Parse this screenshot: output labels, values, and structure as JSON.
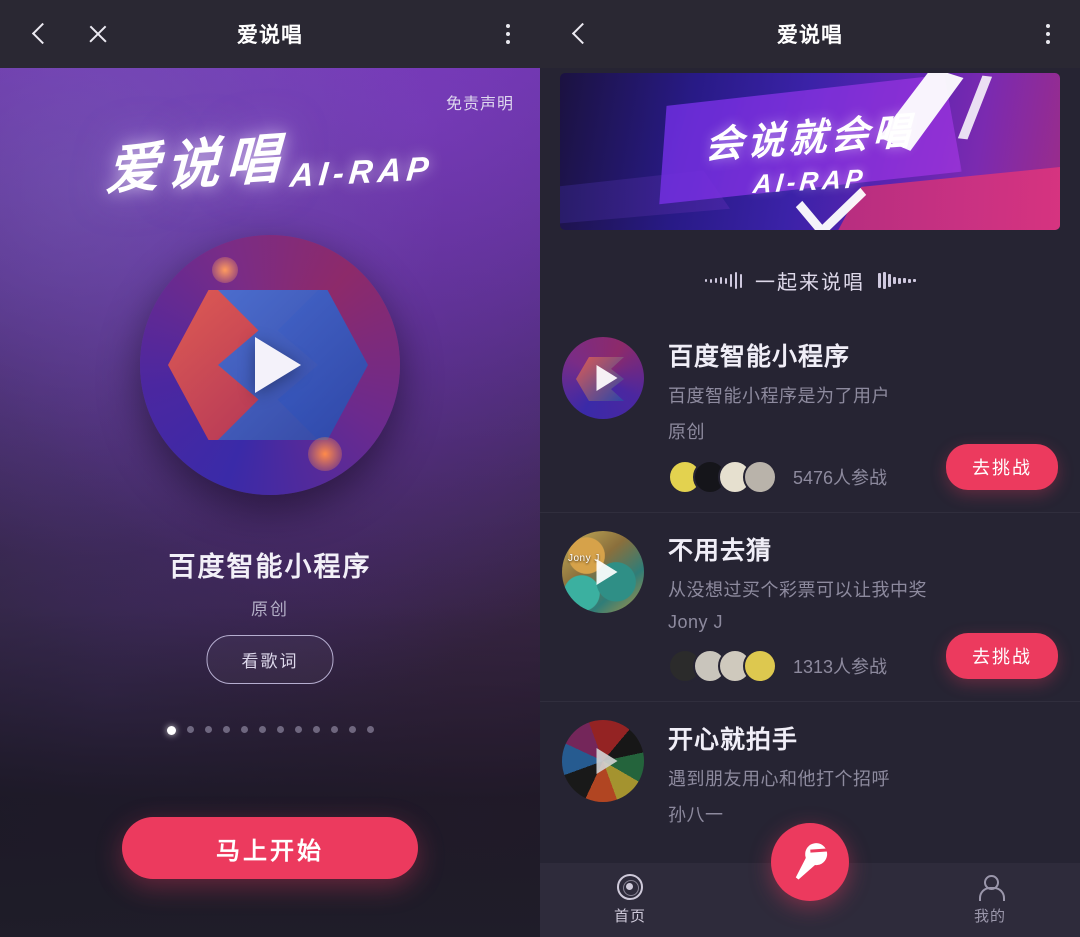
{
  "left": {
    "topbar": {
      "title": "爱说唱",
      "back_icon": "chevron-left-icon",
      "close_icon": "close-icon",
      "menu_icon": "more-vertical-icon"
    },
    "disclaimer": "免责声明",
    "brand_cn": "爱说唱",
    "brand_en": "AI-RAP",
    "song_title": "百度智能小程序",
    "song_author": "原创",
    "lyrics_button": "看歌词",
    "start_button": "马上开始",
    "pagination": {
      "count": 12,
      "active": 0
    }
  },
  "right": {
    "topbar": {
      "title": "爱说唱",
      "back_icon": "chevron-left-icon",
      "menu_icon": "more-vertical-icon"
    },
    "banner": {
      "title_cn": "会说就会唱",
      "title_en": "AI-RAP"
    },
    "section_label": "一起来说唱",
    "items": [
      {
        "title": "百度智能小程序",
        "subtitle": "百度智能小程序是为了用户",
        "author": "原创",
        "count": "5476人参战",
        "button": "去挑战",
        "avatar_colors": [
          "#e3d24f",
          "#15151a",
          "#e6e0cf",
          "#b9b3aa"
        ]
      },
      {
        "title": "不用去猜",
        "subtitle": "从没想过买个彩票可以让我中奖",
        "author": "Jony J",
        "count": "1313人参战",
        "button": "去挑战",
        "avatar_colors": [
          "#2b2b2b",
          "#c9c5bc",
          "#cfc9bd",
          "#ddc84f"
        ],
        "cover_tag": "Jony J"
      },
      {
        "title": "开心就拍手",
        "subtitle": "遇到朋友用心和他打个招呼",
        "author": "孙八一",
        "count": "",
        "button": "",
        "avatar_colors": []
      }
    ],
    "tabbar": {
      "home_label": "首页",
      "mine_label": "我的",
      "home_icon": "disc-icon",
      "mine_icon": "user-icon",
      "fab_icon": "microphone-icon"
    }
  },
  "colors": {
    "accent": "#ec3a5e",
    "bg": "#262433",
    "topbar": "#2a2833",
    "tabbar": "#2e2b3b"
  }
}
